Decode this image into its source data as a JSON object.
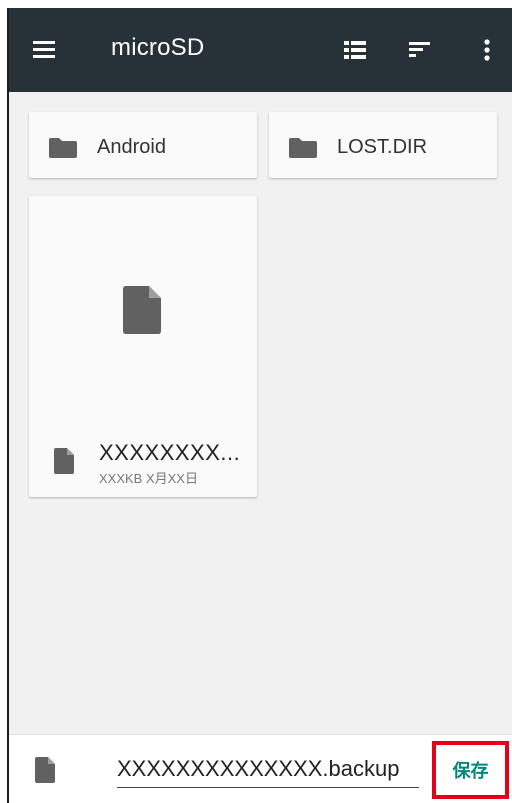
{
  "appbar": {
    "title": "microSD",
    "icons": {
      "menu": "menu-icon",
      "list_view": "list-view-icon",
      "sort": "sort-icon",
      "more": "more-vert-icon"
    },
    "background": "#263238"
  },
  "folders": [
    {
      "name": "Android",
      "icon": "folder-icon"
    },
    {
      "name": "LOST.DIR",
      "icon": "folder-icon"
    }
  ],
  "files": [
    {
      "name": "XXXXXXXX...",
      "meta": "XXXKB X月XX日",
      "icon": "file-icon"
    }
  ],
  "bottombar": {
    "filename_value": "XXXXXXXXXXXXXX.backup",
    "save_label": "保存",
    "save_color": "#00897b",
    "highlight_color": "#e4001b"
  }
}
